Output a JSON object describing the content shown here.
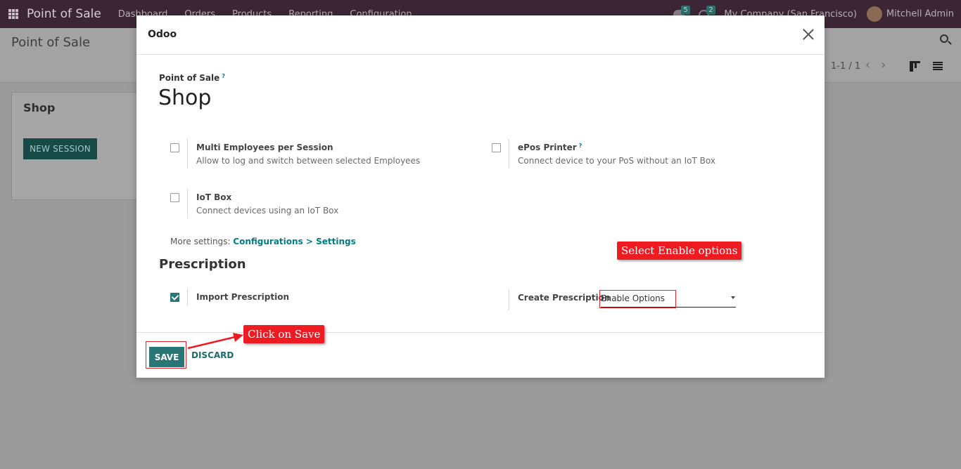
{
  "navbar": {
    "brand": "Point of Sale",
    "menu": [
      "Dashboard",
      "Orders",
      "Products",
      "Reporting",
      "Configuration"
    ],
    "messages_count": "5",
    "activities_count": "2",
    "company": "My Company (San Francisco)",
    "user": "Mitchell Admin"
  },
  "control": {
    "title": "Point of Sale",
    "pager": "1-1 / 1",
    "pager_prev": "‹",
    "pager_next": "›"
  },
  "card": {
    "title": "Shop",
    "button": "NEW SESSION"
  },
  "modal": {
    "title": "Odoo",
    "field_label": "Point of Sale",
    "help_mark": "?",
    "record_name": "Shop",
    "settings": [
      {
        "title": "Multi Employees per Session",
        "desc": "Allow to log and switch between selected Employees",
        "checked": false
      },
      {
        "title": "ePos Printer",
        "desc": "Connect device to your PoS without an IoT Box",
        "checked": false
      },
      {
        "title": "IoT Box",
        "desc": "Connect devices using an IoT Box",
        "checked": false
      }
    ],
    "more_settings_label": "More settings:",
    "more_settings_link": "Configurations > Settings",
    "section_title": "Prescription",
    "import_prescription": {
      "title": "Import Prescription",
      "checked": true
    },
    "create_prescription": {
      "label": "Create Prescription",
      "value": "Enable Options"
    },
    "save": "SAVE",
    "discard": "DISCARD"
  },
  "annotations": {
    "select_hint": "Select Enable options",
    "save_hint": "Click on Save",
    "color": "#ee1c22"
  }
}
